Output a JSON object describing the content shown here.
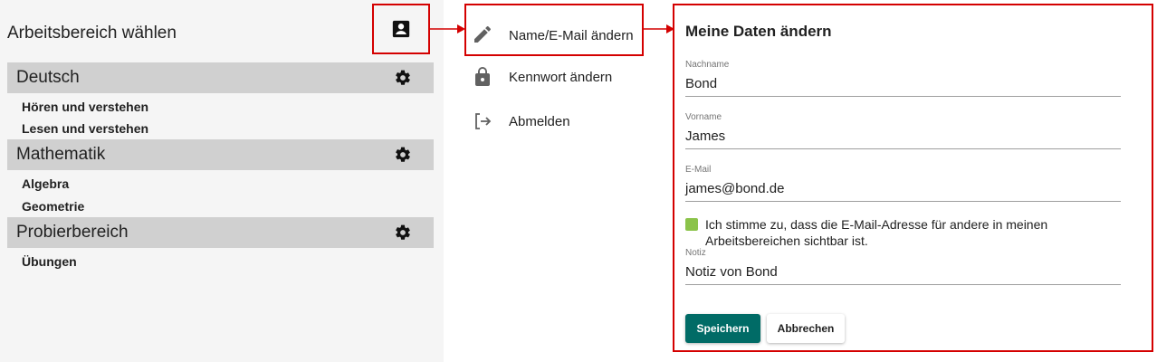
{
  "workspace": {
    "title": "Arbeitsbereich wählen",
    "groups": [
      {
        "name": "Deutsch",
        "items": [
          "Hören und verstehen",
          "Lesen und verstehen"
        ]
      },
      {
        "name": "Mathematik",
        "items": [
          "Algebra",
          "Geometrie"
        ]
      },
      {
        "name": "Probierbereich",
        "items": [
          "Übungen"
        ]
      }
    ]
  },
  "account_menu": {
    "icon": "contact-card-icon",
    "items": [
      {
        "label": "Name/E-Mail ändern",
        "icon": "pencil-icon",
        "active": true
      },
      {
        "label": "Kennwort ändern",
        "icon": "lock-icon",
        "active": false
      },
      {
        "label": "Abmelden",
        "icon": "logout-icon",
        "active": false
      }
    ]
  },
  "form": {
    "title": "Meine Daten ändern",
    "lastname_label": "Nachname",
    "lastname_value": "Bond",
    "firstname_label": "Vorname",
    "firstname_value": "James",
    "email_label": "E-Mail",
    "email_value": "james@bond.de",
    "consent_text": "Ich stimme zu, dass die E-Mail-Adresse für andere in meinen Arbeitsbereichen sichtbar ist.",
    "consent_checked": true,
    "note_label": "Notiz",
    "note_value": "Notiz von Bond",
    "save_label": "Speichern",
    "cancel_label": "Abbrechen"
  },
  "colors": {
    "highlight": "#d40000",
    "primary": "#006b66",
    "checkbox": "#8bc34a",
    "section_header": "#d0d0d0"
  }
}
